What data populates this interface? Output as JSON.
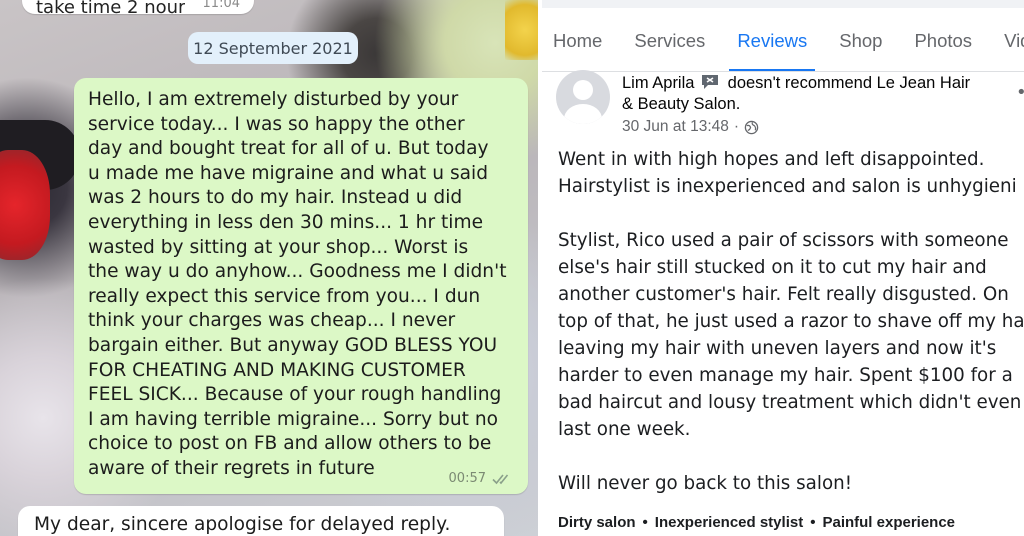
{
  "chat": {
    "prev_message_partial": "take time 2 nour",
    "prev_message_time": "11:04",
    "date_chip": "12 September 2021",
    "outgoing_message": "Hello, I am extremely disturbed by your\nservice today... I was so happy the other\nday and bought treat for all of u. But today\nu made me have migraine and what u said\nwas 2 hours to do my hair. Instead u did\neverything in less den 30 mins... 1 hr time\nwasted by sitting at your shop... Worst is\nthe way u do anyhow... Goodness me I didn't\nreally expect this service from you... I dun\nthink your charges was cheap... I never\nbargain either. But anyway GOD BLESS YOU\nFOR CHEATING AND MAKING CUSTOMER\nFEEL SICK... Because of your rough handling\nI am having terrible migraine... Sorry but no\nchoice to post on FB and allow others to be\naware of their regrets in future",
    "outgoing_time": "00:57",
    "incoming_message": "My dear, sincere apologise for delayed reply."
  },
  "facebook": {
    "tabs": [
      {
        "label": "Home",
        "active": false
      },
      {
        "label": "Services",
        "active": false
      },
      {
        "label": "Reviews",
        "active": true
      },
      {
        "label": "Shop",
        "active": false
      },
      {
        "label": "Photos",
        "active": false
      },
      {
        "label": "Vid",
        "active": false
      }
    ],
    "review": {
      "reviewer": "Lim Aprila",
      "verdict": "doesn't recommend Le Jean Hair",
      "business_line2": "& Beauty Salon.",
      "timestamp": "30 Jun at 13:48",
      "visibility_icon": "globe-icon",
      "more_icon": "more-options-icon",
      "paragraph1_line1": "Went in with high hopes and left disappointed.",
      "paragraph1_line2": "Hairstylist is inexperienced and salon is unhygieni",
      "paragraph2_line1": "Stylist, Rico used a pair of scissors with someone",
      "paragraph2_line2": "else's hair still stucked on it to cut my hair and",
      "paragraph2_line3": "another customer's hair. Felt really disgusted. On",
      "paragraph2_line4": "top of that, he just used a razor to shave off my hai",
      "paragraph2_line5": "leaving my hair with uneven layers and now it's",
      "paragraph2_line6": "harder to even manage my hair. Spent $100 for a",
      "paragraph2_line7": "bad haircut and lousy treatment which didn't even",
      "paragraph2_line8": "last one week.",
      "paragraph3": "Will never go back to this salon!",
      "tags": [
        "Dirty salon",
        "Inexperienced stylist",
        "Painful experience"
      ]
    }
  },
  "colors": {
    "outgoing_bubble": "#dcf8c6",
    "incoming_bubble": "#ffffff",
    "date_chip": "#e3f0fb",
    "fb_active_tab": "#1877f2",
    "fb_muted_text": "#65676b"
  }
}
